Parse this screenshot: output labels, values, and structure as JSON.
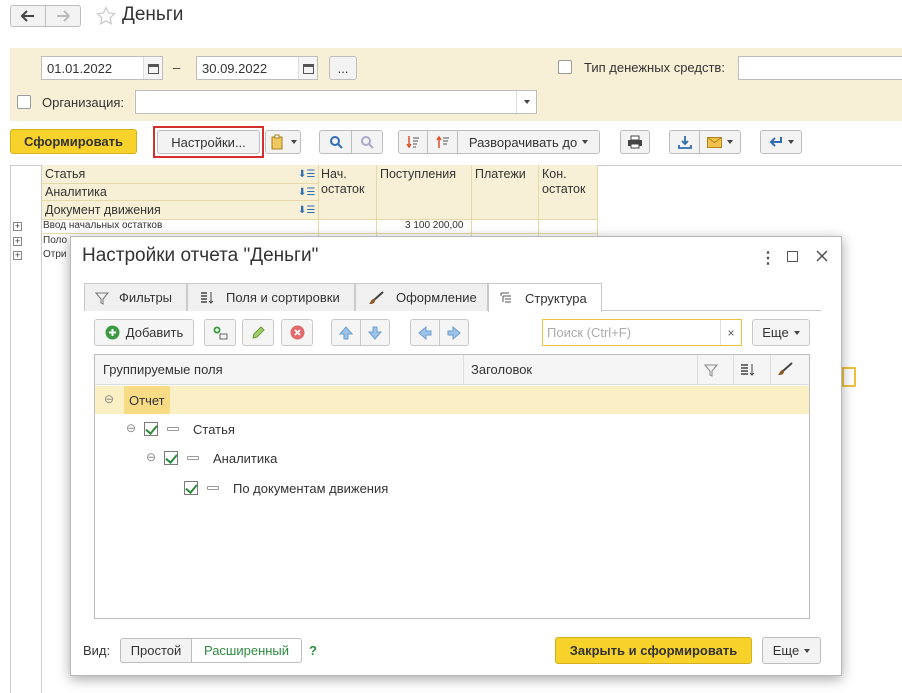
{
  "window": {
    "title": "Деньги"
  },
  "filters": {
    "date_from": "01.01.2022",
    "date_sep": "–",
    "date_to": "30.09.2022",
    "ellipsis": "...",
    "cash_type_label": "Тип денежных средств:",
    "org_label": "Организация:"
  },
  "toolbar": {
    "generate": "Сформировать",
    "settings": "Настройки...",
    "expand_to": "Разворачивать до"
  },
  "report": {
    "group_headers": [
      "Статья",
      "Аналитика",
      "Документ движения"
    ],
    "columns": [
      "Нач. остаток",
      "Поступления",
      "Платежи",
      "Кон. остаток"
    ],
    "rows": [
      {
        "label": "Ввод начальных остатков",
        "receipts": "3 100 200,00"
      },
      {
        "label": "Поло"
      },
      {
        "label": "Отри"
      }
    ]
  },
  "dialog": {
    "title": "Настройки отчета \"Деньги\"",
    "tabs": [
      "Фильтры",
      "Поля и сортировки",
      "Оформление",
      "Структура"
    ],
    "add": "Добавить",
    "search_placeholder": "Поиск (Ctrl+F)",
    "more": "Еще",
    "grid_headers": {
      "fields": "Группируемые поля",
      "caption": "Заголовок"
    },
    "tree": [
      "Отчет",
      "Статья",
      "Аналитика",
      "По документам движения"
    ],
    "view_label": "Вид:",
    "view_simple": "Простой",
    "view_extended": "Расширенный",
    "help": "?",
    "close_generate": "Закрыть и сформировать"
  },
  "colors": {
    "accent_yellow": "#f7d22a",
    "report_bg": "#fbf5dc",
    "highlight_red": "#d32f2f"
  }
}
